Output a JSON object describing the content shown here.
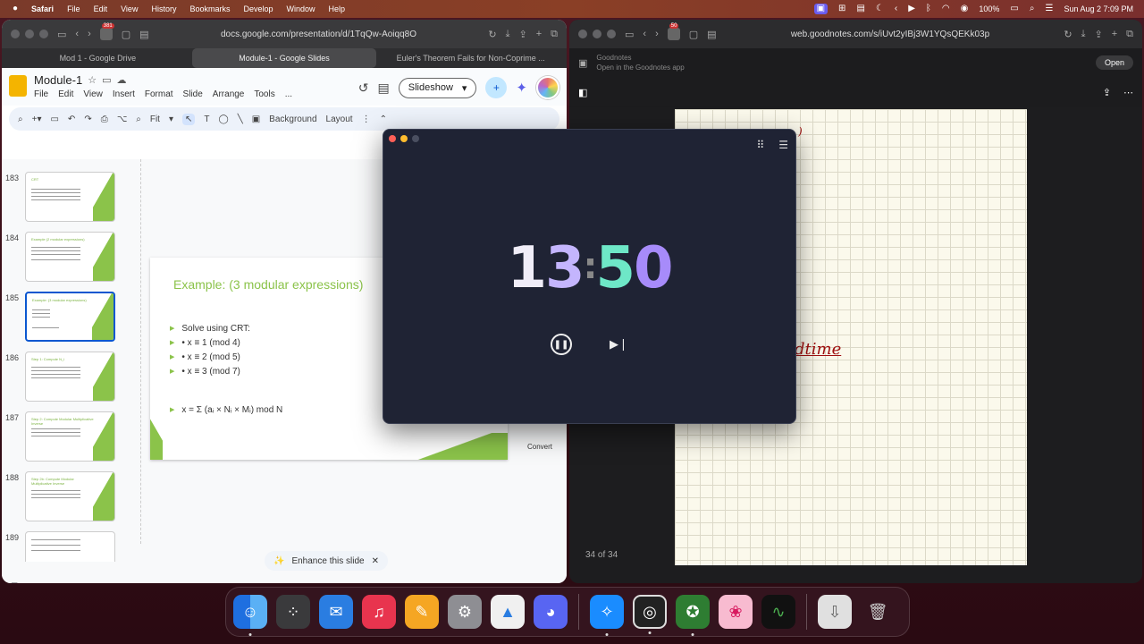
{
  "menubar": {
    "apple": "",
    "app": "Safari",
    "items": [
      "File",
      "Edit",
      "View",
      "History",
      "Bookmarks",
      "Develop",
      "Window",
      "Help"
    ],
    "battery": "100%",
    "datetime": "Sun Aug 2  7:09 PM"
  },
  "left_browser": {
    "badge": "381",
    "url": "docs.google.com/presentation/d/1TqQw-Aoiqq8O",
    "tabs": [
      {
        "label": "Mod 1 - Google Drive"
      },
      {
        "label": "Module-1 - Google Slides"
      },
      {
        "label": "Euler's Theorem Fails for Non-Coprime ..."
      }
    ]
  },
  "slides_app": {
    "title": "Module-1",
    "menu": [
      "File",
      "Edit",
      "View",
      "Insert",
      "Format",
      "Slide",
      "Arrange",
      "Tools",
      "..."
    ],
    "slideshow_label": "Slideshow",
    "toolbar": {
      "zoom": "Fit",
      "background": "Background",
      "layout": "Layout"
    },
    "thumbnails": [
      {
        "num": "183",
        "title": "CRT"
      },
      {
        "num": "184",
        "title": "Example (2 modular expressions)"
      },
      {
        "num": "185",
        "title": "Example: (3 modular expressions)"
      },
      {
        "num": "186",
        "title": "Step 1: Compute N_i"
      },
      {
        "num": "187",
        "title": "Step 2: Compute Modular Multiplicative Inverse"
      },
      {
        "num": "188",
        "title": "Step 2b: Compute Modular Multiplicative Inverse"
      },
      {
        "num": "189",
        "title": ""
      }
    ],
    "slide": {
      "title": "Example: (3 modular expressions)",
      "bullets": [
        "Solve using CRT:",
        "• x ≡ 1 (mod 4)",
        "• x ≡ 2 (mod 5)",
        "• x ≡ 3 (mod 7)"
      ],
      "formula": "x = Σ (aᵢ × Nᵢ × Mᵢ) mod N"
    },
    "convert": "Convert",
    "enhance": "Enhance this slide"
  },
  "right_browser": {
    "badge": "50",
    "url": "web.goodnotes.com/s/iUvt2yIBj3W1YQsQEKk03p"
  },
  "goodnotes": {
    "app_name": "Goodnotes",
    "app_sub": "Open in the Goodnotes app",
    "open": "Open",
    "page_count": "34 of 34",
    "ink_word": "dtime"
  },
  "timer": {
    "d1": "1",
    "d2": "3",
    "colon": ":",
    "d3": "5",
    "d4": "0"
  },
  "dock": [
    "finder-icon",
    "launchpad-icon",
    "mail-icon",
    "music-icon",
    "pages-icon",
    "settings-icon",
    "creative-icon",
    "discord-icon",
    "safari-icon",
    "obs-icon",
    "stickies-icon",
    "pdf-icon",
    "activity-icon",
    "downloads-icon",
    "trash-icon"
  ],
  "colors": {
    "slide_accent": "#8bc34a",
    "timer_bg": "#1f2334",
    "menubar": "#8a3f26"
  }
}
